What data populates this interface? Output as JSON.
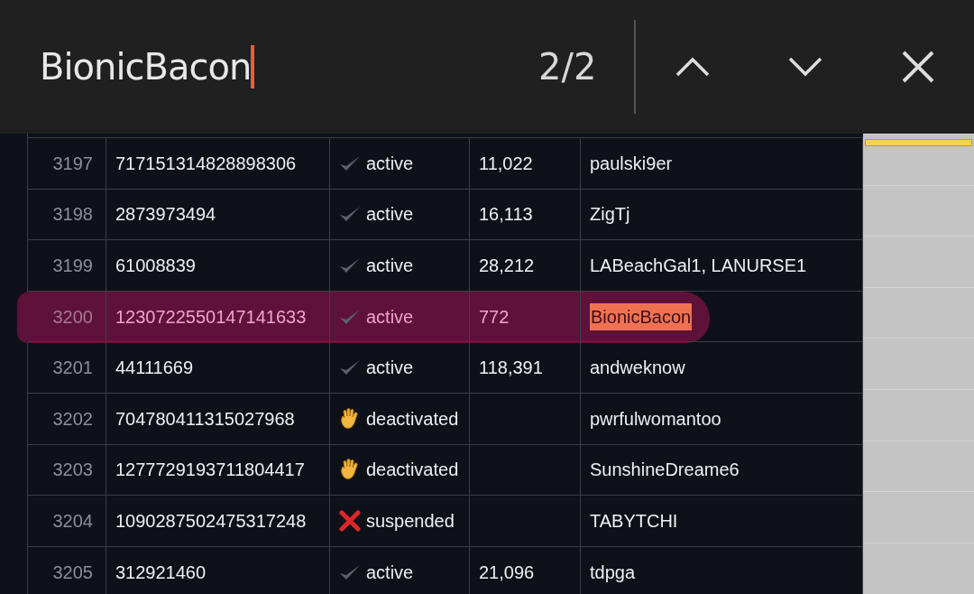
{
  "find_bar": {
    "query": "BionicBacon",
    "match_count": "2/2"
  },
  "rows": [
    {
      "line": "3197",
      "id": "717151314828898306",
      "status": {
        "kind": "active",
        "label": "active"
      },
      "count": "11,022",
      "names": "paulski9er",
      "highlighted": false,
      "match": false
    },
    {
      "line": "3198",
      "id": "2873973494",
      "status": {
        "kind": "active",
        "label": "active"
      },
      "count": "16,113",
      "names": "ZigTj",
      "highlighted": false,
      "match": false
    },
    {
      "line": "3199",
      "id": "61008839",
      "status": {
        "kind": "active",
        "label": "active"
      },
      "count": "28,212",
      "names": "LABeachGal1, LANURSE1",
      "highlighted": false,
      "match": false
    },
    {
      "line": "3200",
      "id": "1230722550147141633",
      "status": {
        "kind": "active",
        "label": "active"
      },
      "count": "772",
      "names": "BionicBacon",
      "highlighted": true,
      "match": true
    },
    {
      "line": "3201",
      "id": "44111669",
      "status": {
        "kind": "active",
        "label": "active"
      },
      "count": "118,391",
      "names": "andweknow",
      "highlighted": false,
      "match": false
    },
    {
      "line": "3202",
      "id": "704780411315027968",
      "status": {
        "kind": "deactivated",
        "label": "deactivated"
      },
      "names": "pwrfulwomantoo",
      "highlighted": false,
      "match": false
    },
    {
      "line": "3203",
      "id": "1277729193711804417",
      "status": {
        "kind": "deactivated",
        "label": "deactivated"
      },
      "names": "SunshineDreame6",
      "highlighted": false,
      "match": false
    },
    {
      "line": "3204",
      "id": "1090287502475317248",
      "status": {
        "kind": "suspended",
        "label": "suspended"
      },
      "names": "TABYTCHI",
      "highlighted": false,
      "match": false
    },
    {
      "line": "3205",
      "id": "312921460",
      "status": {
        "kind": "active",
        "label": "active"
      },
      "count": "21,096",
      "names": "tdpga",
      "highlighted": false,
      "match": false
    }
  ]
}
